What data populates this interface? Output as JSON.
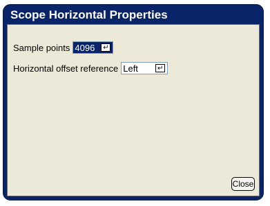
{
  "window": {
    "title": "Scope Horizontal Properties"
  },
  "sample_points": {
    "label": "Sample points",
    "value": "4096",
    "enter_glyph": "↵"
  },
  "horizontal_offset": {
    "label": "Horizontal offset reference",
    "value": "Left",
    "enter_glyph": "↵"
  },
  "buttons": {
    "close_label": "Close"
  },
  "colors": {
    "title_bar": "#0a246a",
    "client_bg": "#ece9d8",
    "selected_field": "#0a246a"
  },
  "icons": [
    "enter-key-icon"
  ]
}
